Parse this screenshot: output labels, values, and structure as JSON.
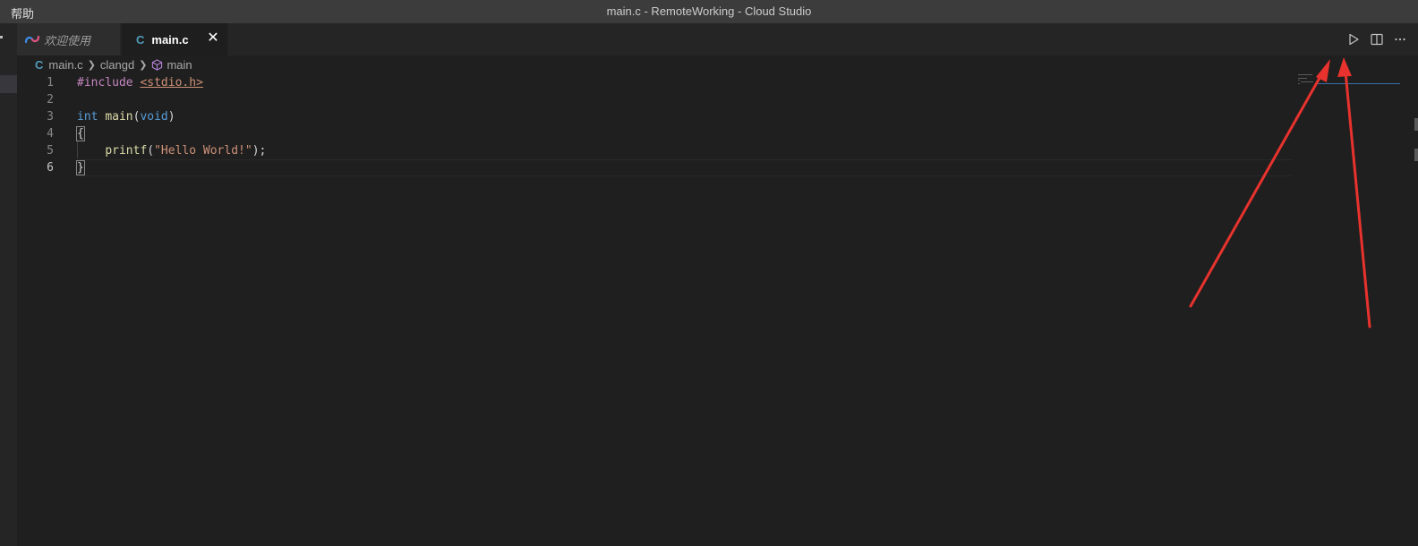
{
  "window": {
    "menu_label": "帮助",
    "title": "main.c - RemoteWorking - Cloud Studio"
  },
  "tabs": [
    {
      "label": "欢迎使用",
      "icon": "cloud-studio-logo-icon",
      "active": false
    },
    {
      "label": "main.c",
      "icon": "c-file-icon",
      "active": true,
      "close_glyph": "✕"
    }
  ],
  "editor_actions": [
    {
      "name": "run-button",
      "icon": "play-icon"
    },
    {
      "name": "split-editor-button",
      "icon": "split-icon"
    },
    {
      "name": "more-actions-button",
      "icon": "ellipsis-icon"
    }
  ],
  "breadcrumb": {
    "file_icon": "C",
    "file": "main.c",
    "folder": "clangd",
    "symbol": "main"
  },
  "code": {
    "lines": [
      {
        "number": "1",
        "tokens": [
          "#include",
          " ",
          "<stdio.h>"
        ]
      },
      {
        "number": "2",
        "tokens": []
      },
      {
        "number": "3",
        "tokens": [
          "int",
          " ",
          "main",
          "(",
          "void",
          ")"
        ]
      },
      {
        "number": "4",
        "tokens": [
          "{"
        ]
      },
      {
        "number": "5",
        "tokens": [
          "    ",
          "printf",
          "(",
          "\"Hello World!\"",
          ");"
        ]
      },
      {
        "number": "6",
        "tokens": [
          "}"
        ]
      }
    ],
    "current_line": "6"
  },
  "annotation": {
    "arrow_color": "#e8322d",
    "arrows_point_to": [
      "run-button"
    ]
  }
}
